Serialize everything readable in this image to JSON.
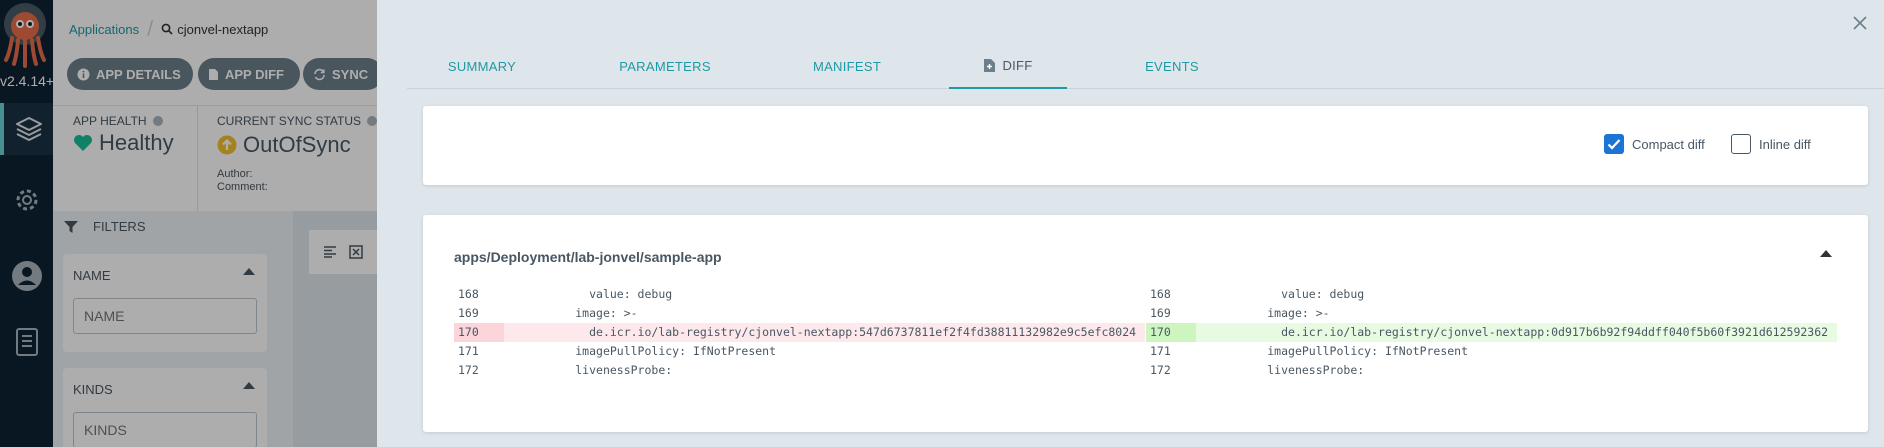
{
  "nav": {
    "version": "v2.4.14+",
    "items": [
      "Applications",
      "Settings",
      "User Info",
      "Documentation"
    ]
  },
  "app": {
    "breadcrumb": {
      "applications": "Applications",
      "current": "cjonvel-nextapp"
    },
    "buttons": {
      "details": "APP DETAILS",
      "diff": "APP DIFF",
      "sync": "SYNC"
    },
    "health": {
      "title": "APP HEALTH",
      "value": "Healthy"
    },
    "sync": {
      "title": "CURRENT SYNC STATUS",
      "value": "OutOfSync",
      "author": "Author:",
      "comment": "Comment:"
    },
    "filters": {
      "title": "FILTERS",
      "name_label": "NAME",
      "name_placeholder": "NAME",
      "kinds_label": "KINDS",
      "kinds_placeholder": "KINDS"
    }
  },
  "panel": {
    "tabs": {
      "summary": "SUMMARY",
      "parameters": "PARAMETERS",
      "manifest": "MANIFEST",
      "diff": "DIFF",
      "events": "EVENTS"
    },
    "options": {
      "compact_label": "Compact diff",
      "compact_checked": true,
      "inline_label": "Inline diff",
      "inline_checked": false
    },
    "diff": {
      "resource": "apps/Deployment/lab-jonvel/sample-app",
      "left": [
        {
          "num": "168",
          "code": "            value: debug",
          "type": "ctx"
        },
        {
          "num": "169",
          "code": "          image: >-",
          "type": "ctx"
        },
        {
          "num": "170",
          "code": "            de.icr.io/lab-registry/cjonvel-nextapp:547d6737811ef2f4fd38811132982e9c5efc8024",
          "type": "del"
        },
        {
          "num": "171",
          "code": "          imagePullPolicy: IfNotPresent",
          "type": "ctx"
        },
        {
          "num": "172",
          "code": "          livenessProbe:",
          "type": "ctx"
        }
      ],
      "right": [
        {
          "num": "168",
          "code": "            value: debug",
          "type": "ctx"
        },
        {
          "num": "169",
          "code": "          image: >-",
          "type": "ctx"
        },
        {
          "num": "170",
          "code": "            de.icr.io/lab-registry/cjonvel-nextapp:0d917b6b92f94ddff040f5b60f3921d612592362",
          "type": "add"
        },
        {
          "num": "171",
          "code": "          imagePullPolicy: IfNotPresent",
          "type": "ctx"
        },
        {
          "num": "172",
          "code": "          livenessProbe:",
          "type": "ctx"
        }
      ]
    }
  },
  "colors": {
    "accent": "#1d9aa3",
    "healthy": "#18be94",
    "outofsync": "#f4c030",
    "deleted": "#fde9ec",
    "added": "#e7fbe2"
  }
}
